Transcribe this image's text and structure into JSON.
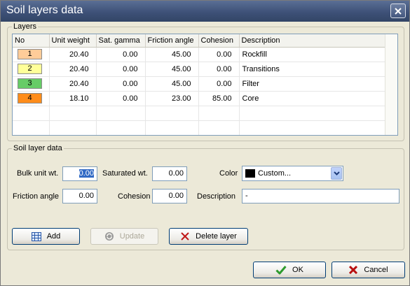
{
  "window": {
    "title": "Soil layers data"
  },
  "layers_group": {
    "label": "Layers"
  },
  "table": {
    "columns": [
      "No",
      "Unit weight",
      "Sat. gamma",
      "Friction angle",
      "Cohesion",
      "Description"
    ],
    "rows": [
      {
        "no": "1",
        "unit_weight": "20.40",
        "sat_gamma": "0.00",
        "friction_angle": "45.00",
        "cohesion": "0.00",
        "description": "Rockfill",
        "color": "#ffcc99"
      },
      {
        "no": "2",
        "unit_weight": "20.40",
        "sat_gamma": "0.00",
        "friction_angle": "45.00",
        "cohesion": "0.00",
        "description": "Transitions",
        "color": "#ffff99"
      },
      {
        "no": "3",
        "unit_weight": "20.40",
        "sat_gamma": "0.00",
        "friction_angle": "45.00",
        "cohesion": "0.00",
        "description": "Filter",
        "color": "#66cc66"
      },
      {
        "no": "4",
        "unit_weight": "18.10",
        "sat_gamma": "0.00",
        "friction_angle": "23.00",
        "cohesion": "85.00",
        "description": "Core",
        "color": "#ff8c1a"
      }
    ]
  },
  "soil_group": {
    "label": "Soil layer data",
    "bulk_label": "Bulk unit wt.",
    "bulk_value": "0.00",
    "saturated_label": "Saturated wt.",
    "saturated_value": "0.00",
    "color_label": "Color",
    "color_value": "Custom...",
    "friction_label": "Friction angle",
    "friction_value": "0.00",
    "cohesion_label": "Cohesion",
    "cohesion_value": "0.00",
    "description_label": "Description",
    "description_value": "-"
  },
  "buttons": {
    "add": "Add",
    "update": "Update",
    "delete": "Delete layer",
    "ok": "OK",
    "cancel": "Cancel"
  },
  "icons": {
    "close": "close-icon",
    "add": "grid-icon",
    "update": "refresh-icon",
    "delete": "delete-x-icon",
    "ok": "checkmark-icon",
    "cancel": "cancel-x-icon",
    "dropdown": "chevron-down-icon"
  }
}
